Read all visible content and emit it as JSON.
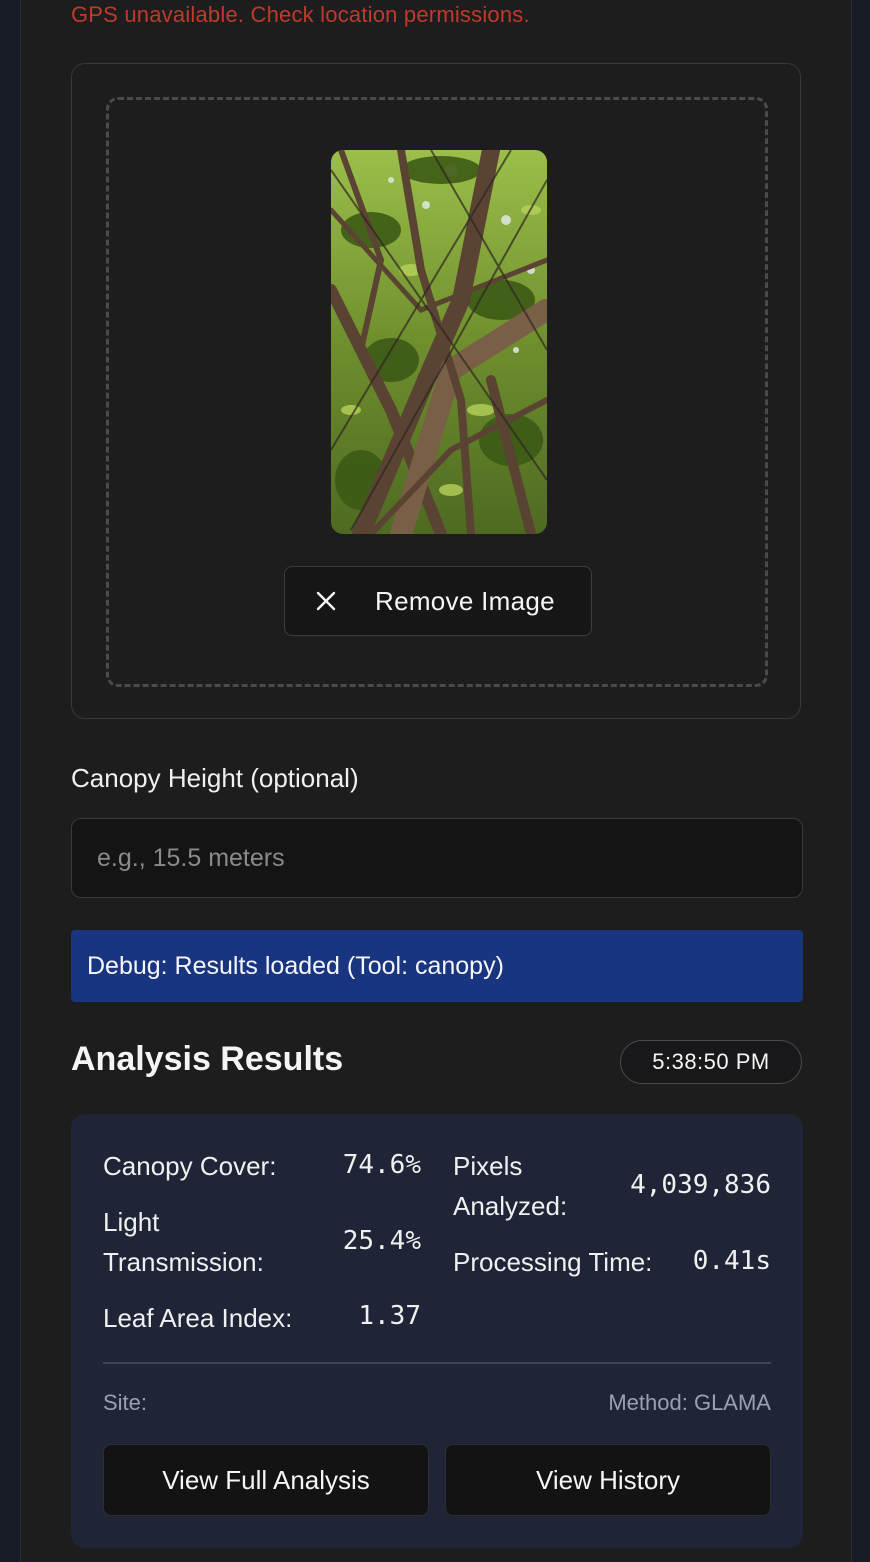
{
  "gps": {
    "error_message": "GPS unavailable. Check location permissions."
  },
  "upload": {
    "preview_icon": "tree-canopy-photo",
    "remove_button_label": "Remove Image",
    "remove_icon": "close-icon"
  },
  "canopy_height": {
    "label": "Canopy Height (optional)",
    "placeholder": "e.g., 15.5 meters",
    "value": ""
  },
  "debug": {
    "message": "Debug: Results loaded (Tool: canopy)"
  },
  "results": {
    "title": "Analysis Results",
    "timestamp": "5:38:50 PM",
    "metrics": {
      "canopy_cover_label": "Canopy Cover:",
      "canopy_cover_value": "74.6%",
      "light_transmission_label_line1": "Light",
      "light_transmission_label_line2": "Transmission:",
      "light_transmission_value": "25.4%",
      "leaf_area_index_label": "Leaf Area Index:",
      "leaf_area_index_value": "1.37",
      "pixels_analyzed_label_line1": "Pixels",
      "pixels_analyzed_label_line2": "Analyzed:",
      "pixels_analyzed_value": "4,039,836",
      "processing_time_label": "Processing Time:",
      "processing_time_value": "0.41s"
    },
    "site_label": "Site:",
    "method_label": "Method: GLAMA",
    "view_full_analysis_label": "View Full Analysis",
    "view_history_label": "View History"
  },
  "colors": {
    "error_red": "#c0392b",
    "debug_blue": "#1a3580",
    "card_background": "#1f2536",
    "page_background": "#1d1d1e"
  }
}
